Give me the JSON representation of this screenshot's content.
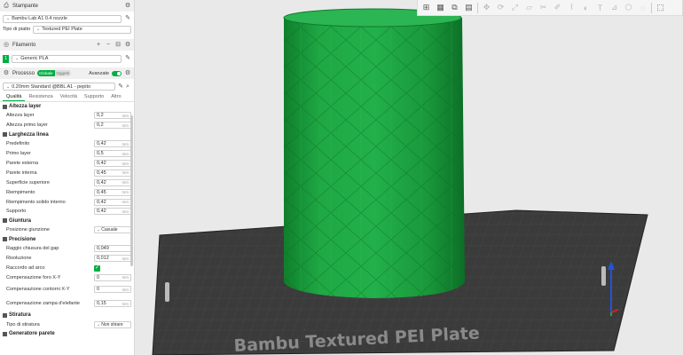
{
  "printer": {
    "section_title": "Stampante",
    "preset": "Bambu Lab A1 0.4 nozzle",
    "plate_label": "Tipo di piatto",
    "plate_value": "Textured PEI Plate"
  },
  "filament": {
    "section_title": "Filamento",
    "slot": "1",
    "value": "Generic PLA",
    "slot_color": "#00ae42"
  },
  "process": {
    "section_title": "Processo",
    "toggle_global": "Globale",
    "toggle_objects": "Oggetti",
    "advanced_label": "Avanzate",
    "preset": "0.20mm Standard @BBL A1 - pepito"
  },
  "tabs": [
    "Qualità",
    "Resistenza",
    "Velocità",
    "Supporto",
    "Altro"
  ],
  "groups": {
    "layer_height": {
      "title": "Altezza layer",
      "params": [
        {
          "label": "Altezza layer",
          "value": "0,2",
          "unit": "mm"
        },
        {
          "label": "Altezza primo layer",
          "value": "0,2",
          "unit": "mm"
        }
      ]
    },
    "line_width": {
      "title": "Larghezza linea",
      "params": [
        {
          "label": "Predefinito",
          "value": "0,42",
          "unit": "mm"
        },
        {
          "label": "Primo layer",
          "value": "0,5",
          "unit": "mm"
        },
        {
          "label": "Parete esterna",
          "value": "0,42",
          "unit": "mm"
        },
        {
          "label": "Parete interna",
          "value": "0,45",
          "unit": "mm"
        },
        {
          "label": "Superficie superiore",
          "value": "0,42",
          "unit": "mm"
        },
        {
          "label": "Riempimento",
          "value": "0,45",
          "unit": "mm"
        },
        {
          "label": "Riempimento solido interno",
          "value": "0,42",
          "unit": "mm"
        },
        {
          "label": "Supporto",
          "value": "0,42",
          "unit": "mm"
        }
      ]
    },
    "seam": {
      "title": "Giuntura",
      "param_label": "Posizione giunzione",
      "param_value": "Casuale"
    },
    "precision": {
      "title": "Precisione",
      "params": [
        {
          "label": "Raggio chiusura del gap",
          "value": "0,049",
          "unit": ""
        },
        {
          "label": "Risoluzione",
          "value": "0,012",
          "unit": "mm"
        }
      ],
      "arc_label": "Raccordo ad arco",
      "params2": [
        {
          "label": "Compensazione foro X-Y",
          "value": "0",
          "unit": "mm"
        },
        {
          "label": "Compensazione contorni X-Y",
          "value": "0",
          "unit": "mm"
        },
        {
          "label": "Compensazione zampa d'elefante",
          "value": "0,15",
          "unit": "mm"
        }
      ]
    },
    "ironing": {
      "title": "Stiratura",
      "param_label": "Tipo di stiratura",
      "param_value": "Non stirare"
    },
    "next_group": "Generatore parete"
  },
  "plate_text": "Bambu Textured PEI Plate",
  "colors": {
    "accent": "#00ae42",
    "model": "#1a9a3a",
    "plate": "#3d3d3d"
  }
}
